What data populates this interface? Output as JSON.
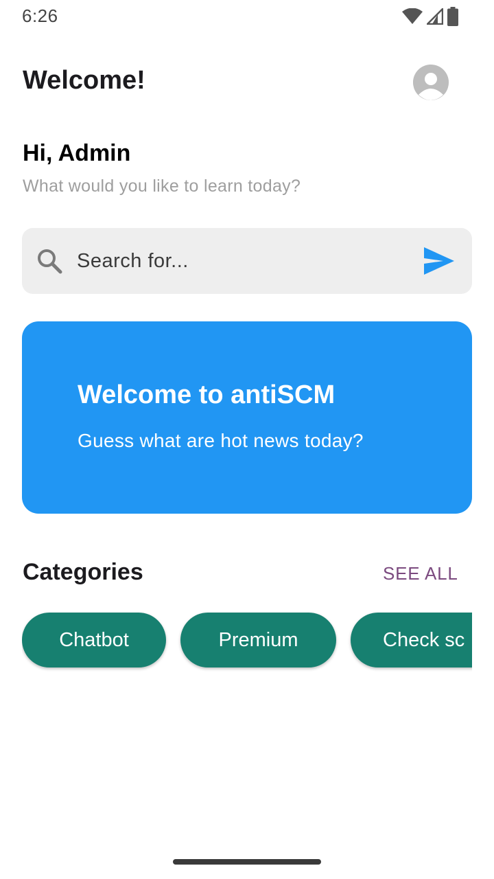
{
  "status_bar": {
    "time": "6:26",
    "icons": [
      "wifi-icon",
      "cell-signal-icon",
      "battery-icon"
    ]
  },
  "app_bar": {
    "title": "Welcome!",
    "avatar_icon": "account-avatar-icon"
  },
  "greeting": {
    "title": "Hi, Admin",
    "subtitle": "What would you like to learn today?"
  },
  "search": {
    "placeholder": "Search for...",
    "value": "",
    "leading_icon": "search-icon",
    "trailing_icon": "send-icon"
  },
  "banner": {
    "title": "Welcome to antiSCM",
    "subtitle": "Guess what are hot news today?",
    "color": "#2196f3"
  },
  "categories": {
    "title": "Categories",
    "see_all": "SEE ALL",
    "items": [
      {
        "label": "Chatbot"
      },
      {
        "label": "Premium"
      },
      {
        "label": "Check sc"
      }
    ],
    "chip_color": "#178070"
  },
  "colors": {
    "accent_blue": "#2196f3",
    "teal": "#178070",
    "link_purple": "#7b4a7f",
    "search_bg": "#eeeeee"
  }
}
